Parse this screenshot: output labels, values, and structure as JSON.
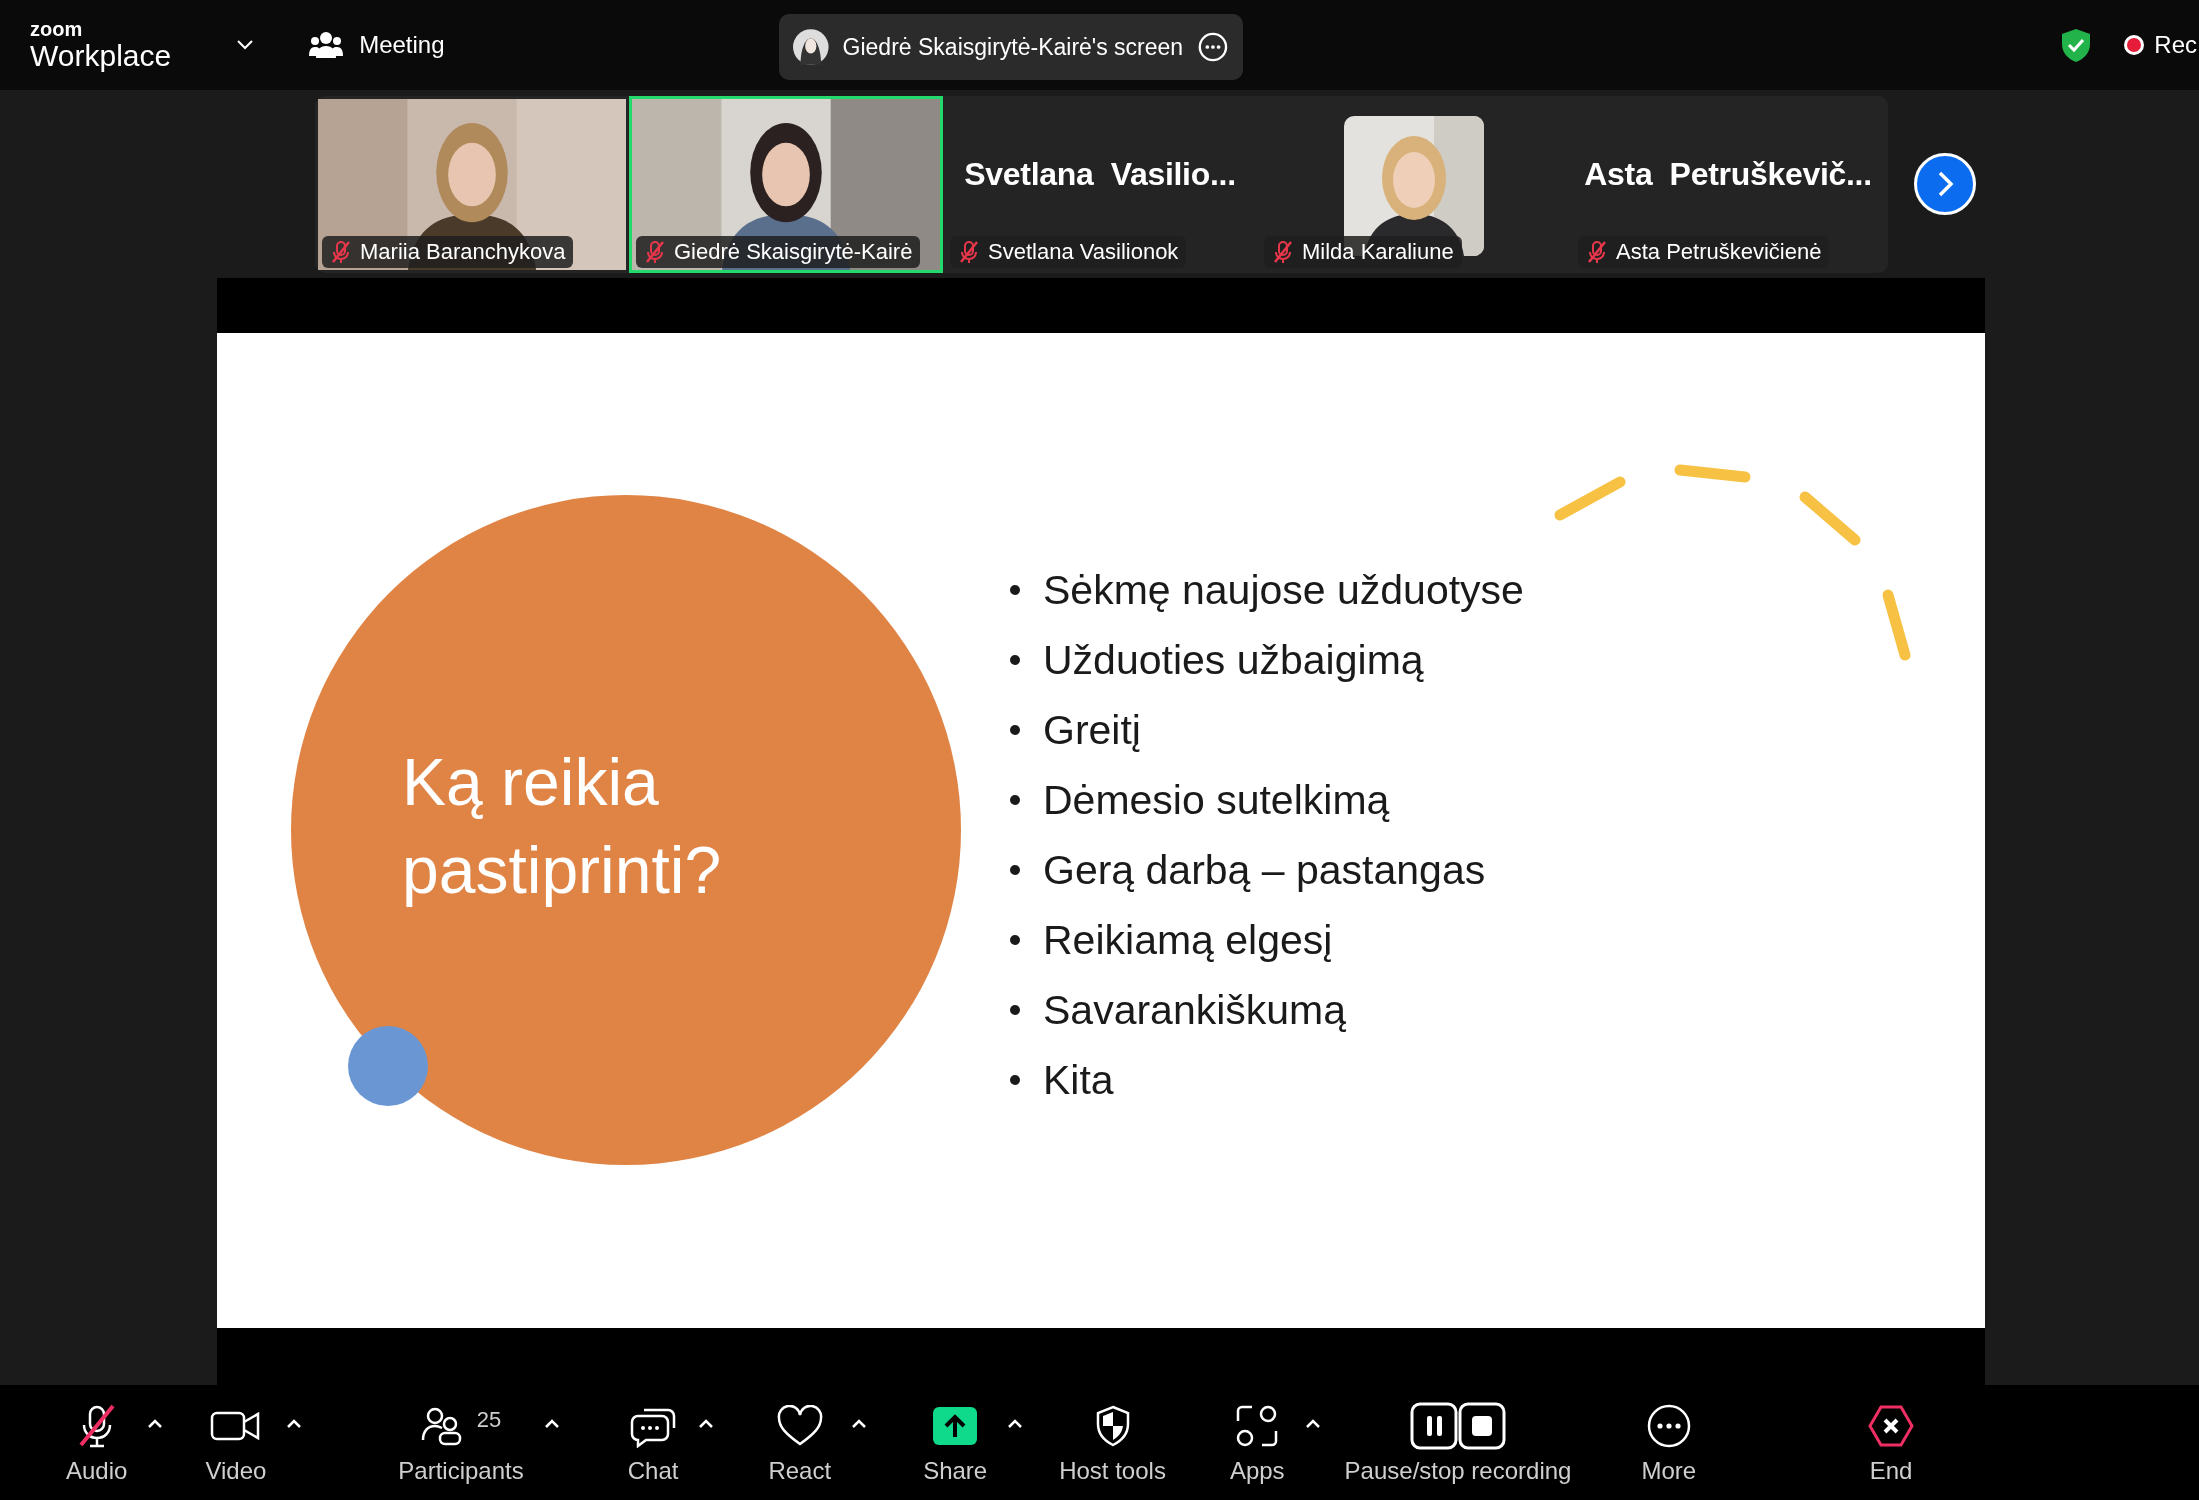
{
  "app": {
    "brand_small": "zoom",
    "brand": "Workplace",
    "meeting_label": "Meeting",
    "share_title": "Giedrė Skaisgirytė-Kairė's screen",
    "recording_label": "Rec"
  },
  "participants": [
    {
      "name": "Mariia Baranchykova",
      "kind": "video",
      "speaking": false,
      "muted": true
    },
    {
      "name": "Giedrė Skaisgirytė-Kairė",
      "kind": "video",
      "speaking": true,
      "muted": true
    },
    {
      "name": "Svetlana Vasilionok",
      "kind": "name",
      "display_name": "Svetlana  Vasilio...",
      "speaking": false,
      "muted": true
    },
    {
      "name": "Milda Karaliune",
      "kind": "avatar",
      "speaking": false,
      "muted": true
    },
    {
      "name": "Asta Petruškevičienė",
      "kind": "name",
      "display_name": "Asta  Petruškevič...",
      "speaking": false,
      "muted": true
    }
  ],
  "slide": {
    "title_lines": [
      "Ką reikia",
      "pastiprinti?"
    ],
    "bullets": [
      "Sėkmę naujose užduotyse",
      "Užduoties užbaigimą",
      "Greitį",
      "Dėmesio sutelkimą",
      "Gerą darbą – pastangas",
      "Reikiamą elgesį",
      "Savarankiškumą",
      "Kita"
    ]
  },
  "toolbar": [
    {
      "kind": "audio",
      "label": "Audio",
      "muted": true
    },
    {
      "kind": "video",
      "label": "Video"
    },
    {
      "kind": "participants",
      "label": "Participants",
      "count": "25"
    },
    {
      "kind": "chat",
      "label": "Chat"
    },
    {
      "kind": "react",
      "label": "React"
    },
    {
      "kind": "share",
      "label": "Share"
    },
    {
      "kind": "host",
      "label": "Host tools"
    },
    {
      "kind": "apps",
      "label": "Apps"
    },
    {
      "kind": "recording",
      "label": "Pause/stop recording"
    },
    {
      "kind": "more",
      "label": "More"
    },
    {
      "kind": "end",
      "label": "End"
    }
  ]
}
